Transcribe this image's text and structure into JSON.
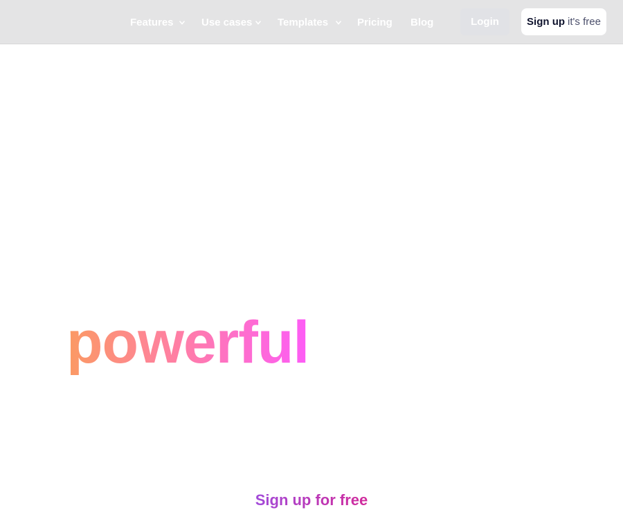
{
  "nav": {
    "items": [
      {
        "label": "Features",
        "has_dropdown": true
      },
      {
        "label": "Use cases",
        "has_dropdown": true
      },
      {
        "label": "Templates",
        "has_dropdown": true
      },
      {
        "label": "Pricing",
        "has_dropdown": false
      },
      {
        "label": "Blog",
        "has_dropdown": false
      }
    ],
    "login_label": "Login",
    "signup_strong": "Sign up",
    "signup_light": "it's free"
  },
  "hero": {
    "word": "powerful",
    "gradient": [
      "#fb9a63",
      "#ff7fa3",
      "#fd5cf7"
    ]
  },
  "cta": {
    "label": "Sign up for free",
    "gradient": [
      "#a24ad9",
      "#d12a9b"
    ]
  },
  "colors": {
    "navbar_bg": "#e4e4e5",
    "nav_text": "#ffffff",
    "signup_bg": "#ffffff",
    "signup_text": "#10142e"
  },
  "icons": [
    "chevron-down-icon"
  ]
}
